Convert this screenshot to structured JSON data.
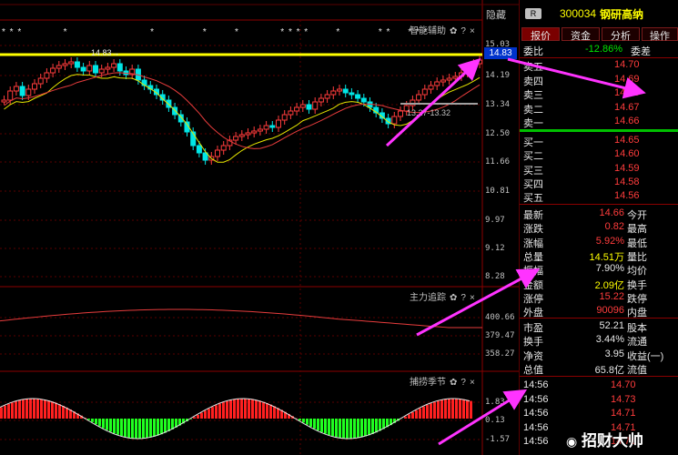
{
  "left_chart": {
    "top_right_label": "隐藏",
    "indicator1_title": "智能辅助",
    "indicator2_title": "主力追踪",
    "indicator3_title": "捕捞季节",
    "price_axis": [
      "15.03",
      "14.19",
      "13.34",
      "12.50",
      "11.66",
      "10.81",
      "9.97",
      "9.12",
      "8.28"
    ],
    "price_marker": "14.83",
    "peak_annotation": "14.83→",
    "low_annotation": "13.27-13.32",
    "indicator2_axis": [
      "400.66",
      "379.47",
      "358.27"
    ],
    "indicator3_axis": [
      "1.83",
      "0.13",
      "-1.57"
    ],
    "star_row": "* * *            *                        *              *        *            * * * *        *           * *     * * *"
  },
  "right_panel": {
    "badge": "R",
    "code": "300034",
    "name": "钢研高纳",
    "tabs": [
      "报价",
      "资金",
      "分析",
      "操作"
    ],
    "weibi_label": "委比",
    "weibi_value": "-12.86%",
    "weicha_label": "委差",
    "asks": [
      {
        "label": "卖五",
        "price": "14.70"
      },
      {
        "label": "卖四",
        "price": "14.69"
      },
      {
        "label": "卖三",
        "price": "14.68"
      },
      {
        "label": "卖二",
        "price": "14.67"
      },
      {
        "label": "卖一",
        "price": "14.66"
      }
    ],
    "bids": [
      {
        "label": "买一",
        "price": "14.65"
      },
      {
        "label": "买二",
        "price": "14.60"
      },
      {
        "label": "买三",
        "price": "14.59"
      },
      {
        "label": "买四",
        "price": "14.58"
      },
      {
        "label": "买五",
        "price": "14.56"
      }
    ],
    "stats": [
      {
        "l1": "最新",
        "v1": "14.66",
        "l2": "今开",
        "c": "red"
      },
      {
        "l1": "涨跌",
        "v1": "0.82",
        "l2": "最高",
        "c": "red"
      },
      {
        "l1": "涨幅",
        "v1": "5.92%",
        "l2": "最低",
        "c": "red"
      },
      {
        "l1": "总量",
        "v1": "14.51万",
        "l2": "量比",
        "c": "yellow"
      },
      {
        "l1": "振幅",
        "v1": "7.90%",
        "l2": "均价",
        "c": "white"
      },
      {
        "l1": "金额",
        "v1": "2.09亿",
        "l2": "换手",
        "c": "yellow"
      },
      {
        "l1": "涨停",
        "v1": "15.22",
        "l2": "跌停",
        "c": "red"
      },
      {
        "l1": "外盘",
        "v1": "90096",
        "l2": "内盘",
        "c": "red"
      }
    ],
    "stats2": [
      {
        "l1": "市盈",
        "v1": "52.21",
        "l2": "股本"
      },
      {
        "l1": "换手",
        "v1": "3.44%",
        "l2": "流通"
      },
      {
        "l1": "净资",
        "v1": "3.95",
        "l2": "收益(一)"
      },
      {
        "l1": "总值",
        "v1": "65.8亿",
        "l2": "流值"
      }
    ],
    "ticks": [
      {
        "time": "14:56",
        "price": "14.70"
      },
      {
        "time": "14:56",
        "price": "14.73"
      },
      {
        "time": "14:56",
        "price": "14.71"
      },
      {
        "time": "14:56",
        "price": "14.71"
      },
      {
        "time": "14:56",
        "price": "14.71"
      }
    ]
  },
  "watermark": "招财大帅"
}
